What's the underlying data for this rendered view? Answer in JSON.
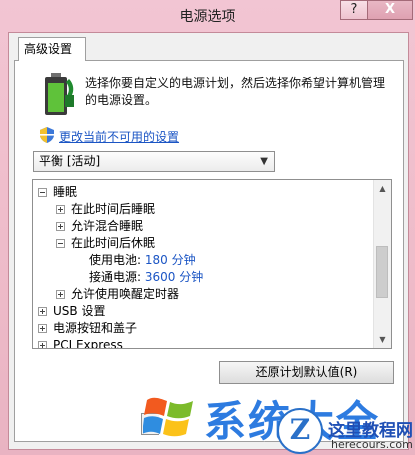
{
  "window": {
    "title": "电源选项",
    "help_label": "?",
    "close_label": "X"
  },
  "tab": {
    "label": "高级设置"
  },
  "intro": {
    "text": "选择你要自定义的电源计划，然后选择你希望计算机管理的电源设置。"
  },
  "link": {
    "label": "更改当前不可用的设置"
  },
  "plan_select": {
    "value": "平衡 [活动]"
  },
  "tree": {
    "items": [
      {
        "label": "睡眠",
        "state": "expanded"
      },
      {
        "label": "在此时间后睡眠",
        "state": "collapsed"
      },
      {
        "label": "允许混合睡眠",
        "state": "collapsed"
      },
      {
        "label": "在此时间后休眠",
        "state": "expanded"
      },
      {
        "label": "使用电池:",
        "value": "180 分钟"
      },
      {
        "label": "接通电源:",
        "value": "3600 分钟"
      },
      {
        "label": "允许使用唤醒定时器",
        "state": "collapsed"
      },
      {
        "label": "USB 设置",
        "state": "collapsed"
      },
      {
        "label": "电源按钮和盖子",
        "state": "collapsed"
      },
      {
        "label": "PCI Express",
        "state": "collapsed"
      }
    ]
  },
  "buttons": {
    "restore_label": "还原计划默认值(R)"
  },
  "watermark": {
    "brand_cn": "系统大全",
    "badge": "Z",
    "site_cn": "这里教程网",
    "site_en": "herecours.com"
  }
}
